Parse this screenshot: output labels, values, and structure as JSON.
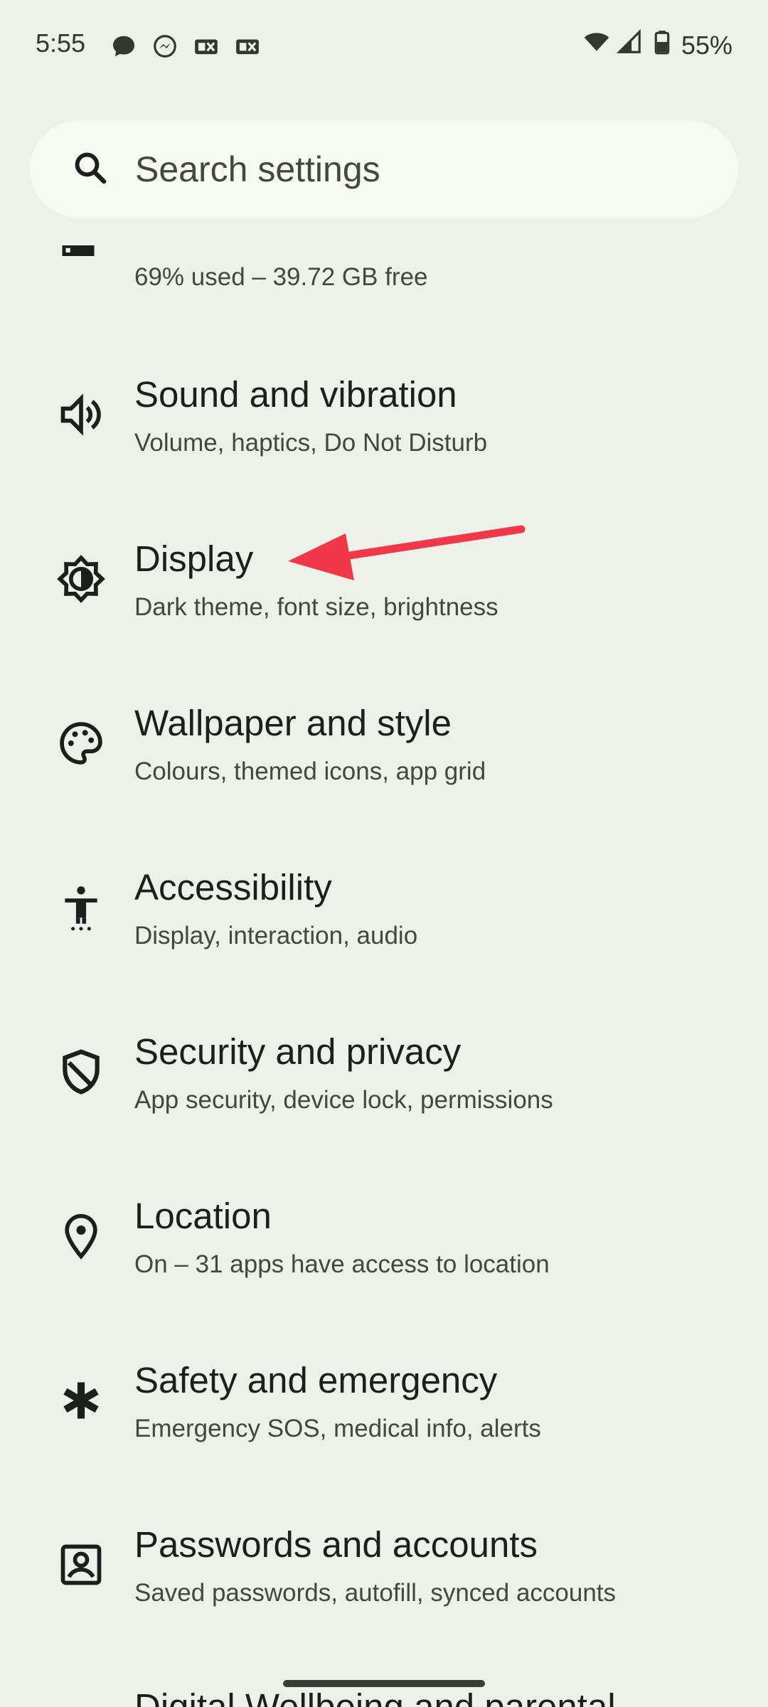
{
  "status_bar": {
    "time": "5:55",
    "battery_percent": "55%",
    "notification_icons": [
      "chat-bubble-icon",
      "messenger-icon",
      "cast-icon",
      "cast-icon"
    ]
  },
  "search": {
    "placeholder": "Search settings"
  },
  "items": [
    {
      "title": "",
      "summary": "69% used – 39.72 GB free",
      "icon": "storage-icon"
    },
    {
      "title": "Sound and vibration",
      "summary": "Volume, haptics, Do Not Disturb",
      "icon": "speaker-icon"
    },
    {
      "title": "Display",
      "summary": "Dark theme, font size, brightness",
      "icon": "brightness-icon"
    },
    {
      "title": "Wallpaper and style",
      "summary": "Colours, themed icons, app grid",
      "icon": "palette-icon"
    },
    {
      "title": "Accessibility",
      "summary": "Display, interaction, audio",
      "icon": "accessibility-icon"
    },
    {
      "title": "Security and privacy",
      "summary": "App security, device lock, permissions",
      "icon": "shield-icon"
    },
    {
      "title": "Location",
      "summary": "On – 31 apps have access to location",
      "icon": "location-pin-icon"
    },
    {
      "title": "Safety and emergency",
      "summary": "Emergency SOS, medical info, alerts",
      "icon": "asterisk-icon"
    },
    {
      "title": "Passwords and accounts",
      "summary": "Saved passwords, autofill, synced accounts",
      "icon": "account-box-icon"
    },
    {
      "title": "Digital Wellbeing and parental",
      "summary": "",
      "icon": ""
    }
  ],
  "colors": {
    "background": "#eef1ea",
    "annotation_arrow": "#f0384a"
  }
}
